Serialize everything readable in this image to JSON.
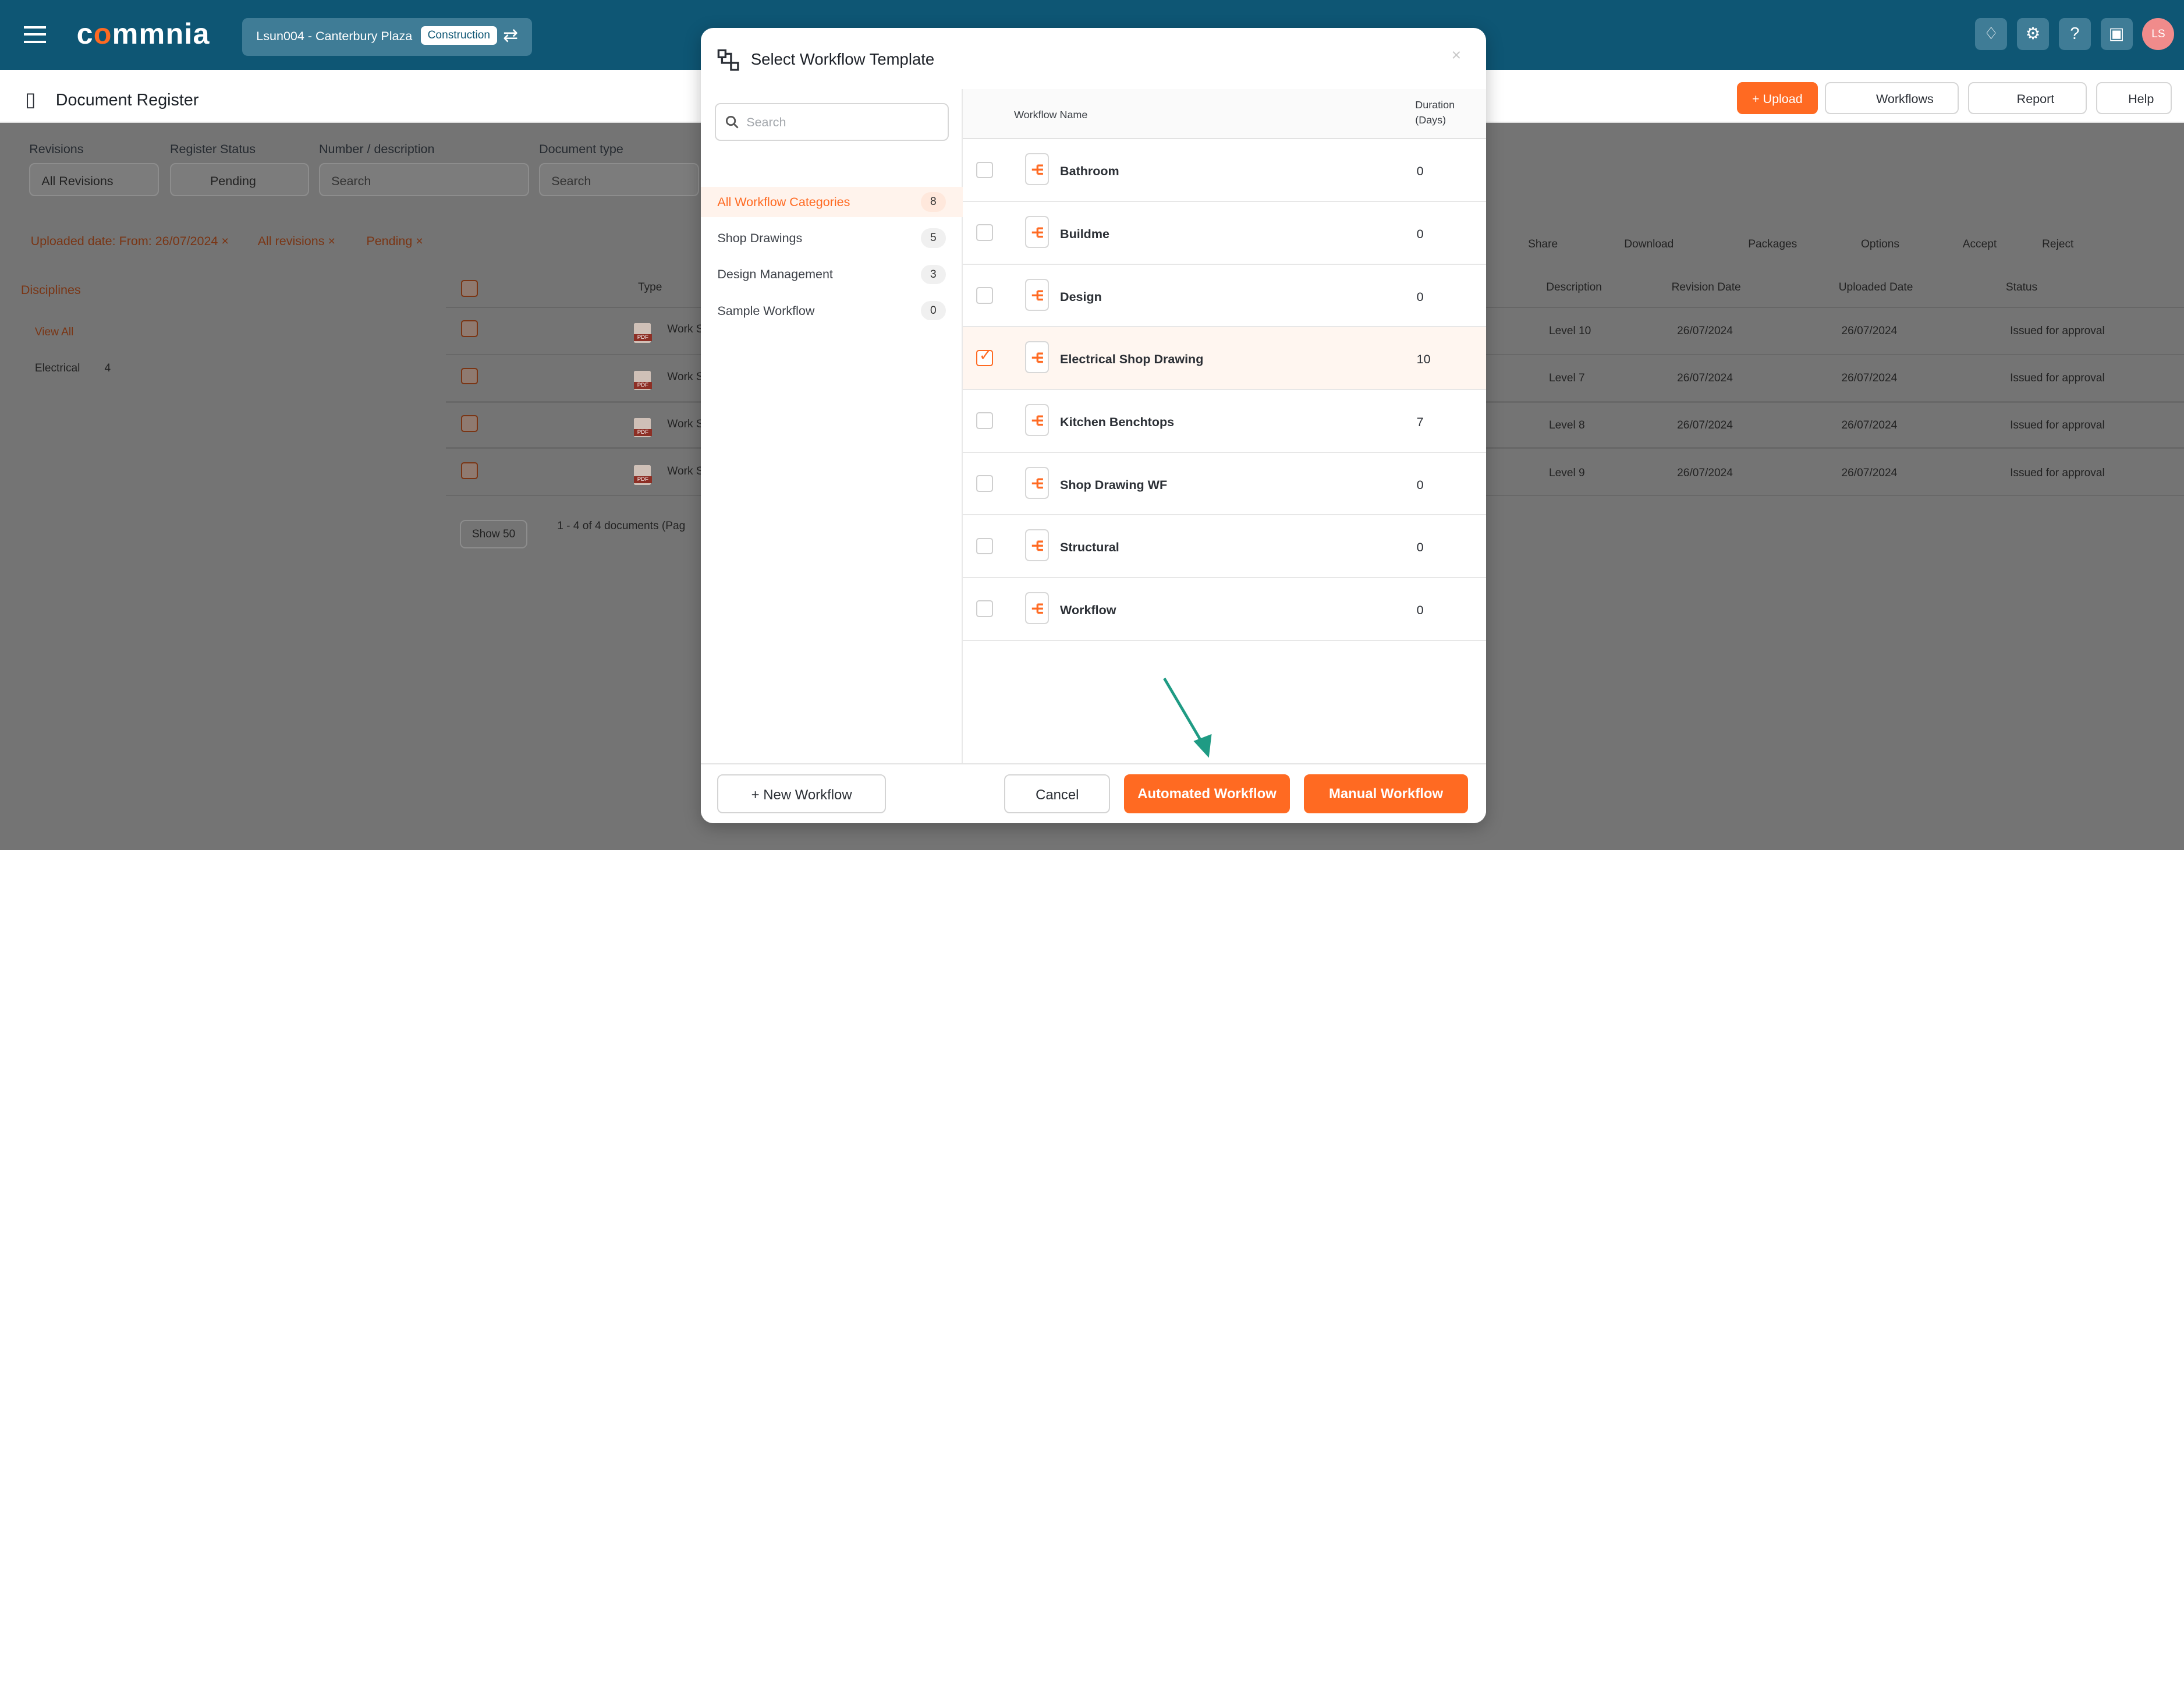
{
  "header": {
    "logo_prefix": "c",
    "logo_o": "o",
    "logo_mid": "mm",
    "logo_suffix": "nia",
    "project_name": "Lsun004 - Canterbury Plaza",
    "project_badge": "Construction",
    "user_initials": "LS"
  },
  "page": {
    "title": "Document Register",
    "upload": "+ Upload",
    "workflows": "Workflows",
    "report": "Report",
    "help": "Help"
  },
  "filters": {
    "revisions_label": "Revisions",
    "revisions_value": "All Revisions",
    "status_label": "Register Status",
    "status_value": "Pending",
    "number_label": "Number / description",
    "number_placeholder": "Search",
    "doctype_label": "Document type",
    "doctype_placeholder": "Search",
    "chips": [
      "Uploaded date: From: 26/07/2024",
      "All revisions",
      "Pending"
    ]
  },
  "background_table": {
    "left_title": "Disciplines",
    "view_all": "View All",
    "discipline": "Electrical",
    "discipline_count": "4",
    "headers": [
      "Type",
      "Description",
      "Revision Date",
      "Uploaded Date",
      "Status"
    ],
    "actions": [
      "Share",
      "Download",
      "Packages",
      "Options",
      "Accept",
      "Reject"
    ],
    "rows": [
      {
        "type": "Work S",
        "description": "Level 10",
        "revision_date": "26/07/2024",
        "uploaded_date": "26/07/2024",
        "status": "Issued for approval"
      },
      {
        "type": "Work S",
        "description": "Level 7",
        "revision_date": "26/07/2024",
        "uploaded_date": "26/07/2024",
        "status": "Issued for approval"
      },
      {
        "type": "Work S",
        "description": "Level 8",
        "revision_date": "26/07/2024",
        "uploaded_date": "26/07/2024",
        "status": "Issued for approval"
      },
      {
        "type": "Work S",
        "description": "Level 9",
        "revision_date": "26/07/2024",
        "uploaded_date": "26/07/2024",
        "status": "Issued for approval"
      }
    ],
    "show": "Show 50",
    "pagination": "1 - 4 of 4 documents (Pag"
  },
  "modal": {
    "title": "Select Workflow Template",
    "close": "×",
    "search_placeholder": "Search",
    "categories": [
      {
        "label": "All Workflow Categories",
        "count": "8",
        "active": true
      },
      {
        "label": "Shop Drawings",
        "count": "5",
        "active": false
      },
      {
        "label": "Design Management",
        "count": "3",
        "active": false
      },
      {
        "label": "Sample Workflow",
        "count": "0",
        "active": false
      }
    ],
    "columns": {
      "name": "Workflow Name",
      "duration_line1": "Duration",
      "duration_line2": "(Days)"
    },
    "workflows": [
      {
        "name": "Bathroom",
        "duration": "0",
        "selected": false
      },
      {
        "name": "Buildme",
        "duration": "0",
        "selected": false
      },
      {
        "name": "Design",
        "duration": "0",
        "selected": false
      },
      {
        "name": "Electrical Shop Drawing",
        "duration": "10",
        "selected": true
      },
      {
        "name": "Kitchen Benchtops",
        "duration": "7",
        "selected": false
      },
      {
        "name": "Shop Drawing WF",
        "duration": "0",
        "selected": false
      },
      {
        "name": "Structural",
        "duration": "0",
        "selected": false
      },
      {
        "name": "Workflow",
        "duration": "0",
        "selected": false
      }
    ],
    "footer": {
      "new_workflow": "+ New Workflow",
      "cancel": "Cancel",
      "automated": "Automated Workflow",
      "manual": "Manual Workflow"
    }
  },
  "colors": {
    "brand": "#0e5674",
    "accent": "#ff6a22",
    "arrow": "#1f9b84"
  }
}
